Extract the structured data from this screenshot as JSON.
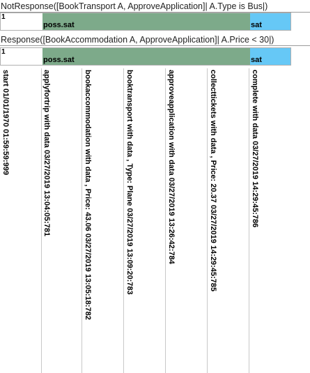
{
  "constraints": [
    {
      "title": "NotResponse([BookTransport A, ApproveApplication]| A.Type is Bus|)",
      "count": "1",
      "segments": [
        {
          "label": "",
          "color": "#ffffff"
        },
        {
          "label": "poss.sat",
          "color": "#7daa8a"
        },
        {
          "label": "sat",
          "color": "#66c8f6"
        }
      ]
    },
    {
      "title": "Response([BookAccommodation A, ApproveApplication]| A.Price < 30|)",
      "count": "1",
      "segments": [
        {
          "label": "",
          "color": "#ffffff"
        },
        {
          "label": "poss.sat",
          "color": "#7daa8a"
        },
        {
          "label": "sat",
          "color": "#66c8f6"
        }
      ]
    }
  ],
  "events": [
    "start 01/01/1970 01:59:59:999",
    "applyfortrip with data  03/27/2019 13:04:05:781",
    "bookaccommodation with data , Price: 43.06 03/27/2019 13:05:18:782",
    "booktransport with data , Type: Plane 03/27/2019 13:09:20:783",
    "approveapplication with data  03/27/2019 13:26:42:784",
    "collecttickets with data , Price: 20.37 03/27/2019 14:29:45:785",
    "complete with data  03/27/2019 14:29:45:786"
  ]
}
